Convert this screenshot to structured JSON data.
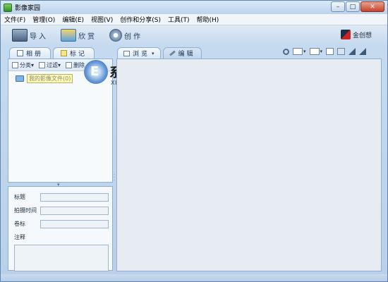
{
  "window": {
    "title": "影像家园",
    "minimize_label": "–",
    "maximize_label": "□",
    "close_label": "✕"
  },
  "menu": [
    "文件(F)",
    "管理(O)",
    "编辑(E)",
    "视图(V)",
    "创作和分享(S)",
    "工具(T)",
    "帮助(H)"
  ],
  "toolbar": {
    "import_label": "导入",
    "view_label": "欣赏",
    "create_label": "创作",
    "brand_label": "金创想"
  },
  "left_tabs": {
    "album_label": "相册",
    "tag_label": "标记"
  },
  "left_tools": {
    "category_label": "分类",
    "filter_label": "过滤",
    "delete_label": "删除"
  },
  "tree": {
    "root_label": "我的影像文件(0)"
  },
  "watermark": {
    "title": "系统之家",
    "domain": "XITONGZHIJIA.NET"
  },
  "properties": {
    "title_label": "标题",
    "date_label": "拍摄时间",
    "volume_label": "卷标",
    "note_label": "注释"
  },
  "right_tabs": {
    "browse_label": "浏览",
    "edit_label": "编辑"
  },
  "colors": {
    "frame_blue": "#b9d0ea",
    "panel_border": "#8fb0d3",
    "content_bg": "#e7ecf2"
  }
}
